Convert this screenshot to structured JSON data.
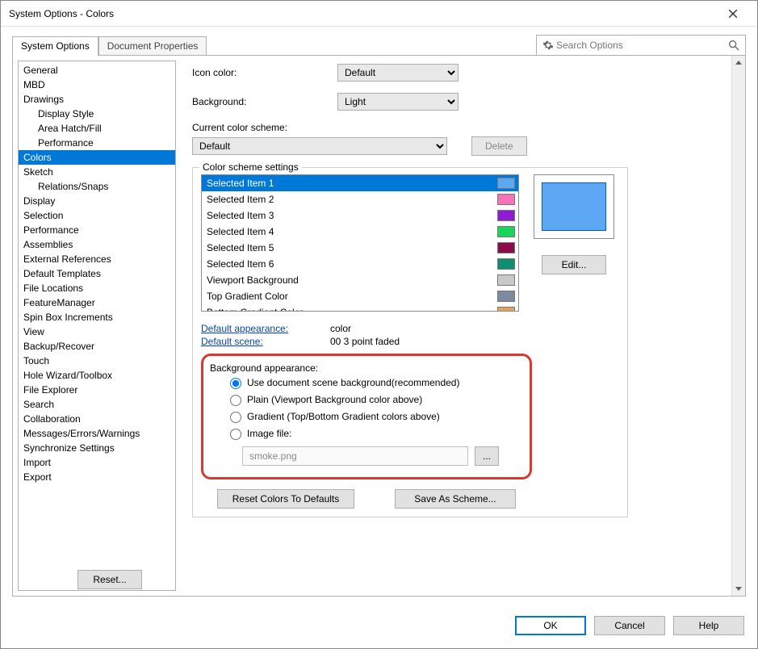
{
  "window": {
    "title": "System Options - Colors"
  },
  "tabs": {
    "system_options": "System Options",
    "document_properties": "Document Properties"
  },
  "search": {
    "placeholder": "Search Options"
  },
  "sidebar": {
    "items": [
      {
        "label": "General",
        "indent": false
      },
      {
        "label": "MBD",
        "indent": false
      },
      {
        "label": "Drawings",
        "indent": false
      },
      {
        "label": "Display Style",
        "indent": true
      },
      {
        "label": "Area Hatch/Fill",
        "indent": true
      },
      {
        "label": "Performance",
        "indent": true
      },
      {
        "label": "Colors",
        "indent": false,
        "selected": true
      },
      {
        "label": "Sketch",
        "indent": false
      },
      {
        "label": "Relations/Snaps",
        "indent": true
      },
      {
        "label": "Display",
        "indent": false
      },
      {
        "label": "Selection",
        "indent": false
      },
      {
        "label": "Performance",
        "indent": false
      },
      {
        "label": "Assemblies",
        "indent": false
      },
      {
        "label": "External References",
        "indent": false
      },
      {
        "label": "Default Templates",
        "indent": false
      },
      {
        "label": "File Locations",
        "indent": false
      },
      {
        "label": "FeatureManager",
        "indent": false
      },
      {
        "label": "Spin Box Increments",
        "indent": false
      },
      {
        "label": "View",
        "indent": false
      },
      {
        "label": "Backup/Recover",
        "indent": false
      },
      {
        "label": "Touch",
        "indent": false
      },
      {
        "label": "Hole Wizard/Toolbox",
        "indent": false
      },
      {
        "label": "File Explorer",
        "indent": false
      },
      {
        "label": "Search",
        "indent": false
      },
      {
        "label": "Collaboration",
        "indent": false
      },
      {
        "label": "Messages/Errors/Warnings",
        "indent": false
      },
      {
        "label": "Synchronize Settings",
        "indent": false
      },
      {
        "label": "Import",
        "indent": false
      },
      {
        "label": "Export",
        "indent": false
      }
    ]
  },
  "form": {
    "icon_color_label": "Icon color:",
    "icon_color_value": "Default",
    "background_label": "Background:",
    "background_value": "Light",
    "scheme_label": "Current color scheme:",
    "scheme_value": "Default",
    "delete": "Delete",
    "fieldset_legend": "Color scheme settings",
    "edit": "Edit...",
    "color_items": [
      {
        "name": "Selected Item 1",
        "color": "#5ca8f5",
        "selected": true
      },
      {
        "name": "Selected Item 2",
        "color": "#f573b6"
      },
      {
        "name": "Selected Item 3",
        "color": "#8f1bd4"
      },
      {
        "name": "Selected Item 4",
        "color": "#18d65a"
      },
      {
        "name": "Selected Item 5",
        "color": "#8a0a4a"
      },
      {
        "name": "Selected Item 6",
        "color": "#0f8f72"
      },
      {
        "name": "Viewport Background",
        "color": "#c9c9c9"
      },
      {
        "name": "Top Gradient Color",
        "color": "#7d8aa0"
      },
      {
        "name": "Bottom Gradient Color",
        "color": "#e8a05a"
      }
    ],
    "default_appearance_label": "Default appearance:",
    "default_appearance_value": "color",
    "default_scene_label": "Default scene:",
    "default_scene_value": "00 3 point faded",
    "bg_appearance_label": "Background appearance:",
    "radio_doc": "Use document scene background(recommended)",
    "radio_plain": "Plain (Viewport Background color above)",
    "radio_gradient": "Gradient (Top/Bottom Gradient colors above)",
    "radio_image": "Image file:",
    "image_value": "smoke.png",
    "browse": "...",
    "reset_colors": "Reset Colors To Defaults",
    "save_scheme": "Save As Scheme...",
    "reset": "Reset..."
  },
  "buttons": {
    "ok": "OK",
    "cancel": "Cancel",
    "help": "Help"
  }
}
